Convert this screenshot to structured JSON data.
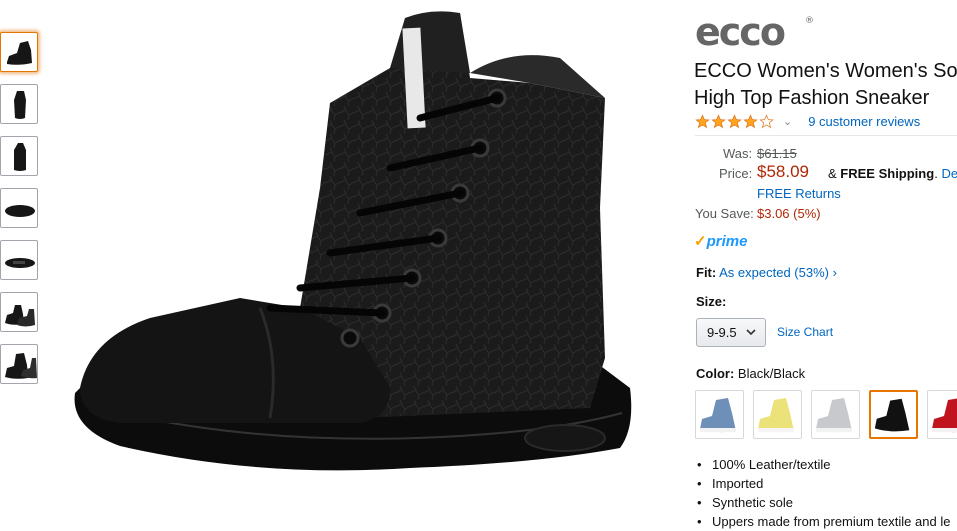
{
  "brand": {
    "logo_text": "ecco",
    "registered_mark": "®"
  },
  "product": {
    "title_line1": "ECCO Women's Women's So",
    "title_line2": "High Top Fashion Sneaker",
    "rating": 4,
    "reviews_link": "9 customer reviews"
  },
  "thumbnails": [
    {
      "name": "side-view",
      "selected": true
    },
    {
      "name": "front-view",
      "selected": false
    },
    {
      "name": "back-view",
      "selected": false
    },
    {
      "name": "sole-view",
      "selected": false
    },
    {
      "name": "top-view",
      "selected": false
    },
    {
      "name": "pair-view",
      "selected": false
    },
    {
      "name": "angle-view",
      "selected": false
    }
  ],
  "price": {
    "was_label": "Was:",
    "was_value": "$61.15",
    "price_label": "Price:",
    "price_value": "$58.09",
    "shipping_amp": "&",
    "shipping_bold": "FREE Shipping",
    "shipping_dot": ".",
    "details_link": "Detail",
    "returns_link": "FREE Returns",
    "save_label": "You Save:",
    "save_value": "$3.06 (5%)"
  },
  "prime": {
    "check": "✓",
    "label": "prime"
  },
  "fit": {
    "label": "Fit:",
    "value": "As expected (53%)",
    "chevron": "›"
  },
  "size": {
    "label": "Size:",
    "selected": "9-9.5",
    "chart_link": "Size Chart"
  },
  "color": {
    "label": "Color:",
    "value": "Black/Black",
    "swatches": [
      {
        "name": "denim-blue",
        "hex": "#6d8fb8",
        "selected": false
      },
      {
        "name": "yellow",
        "hex": "#ece27a",
        "selected": false
      },
      {
        "name": "light-grey",
        "hex": "#c7c9cc",
        "selected": false
      },
      {
        "name": "black",
        "hex": "#111111",
        "selected": true
      },
      {
        "name": "red",
        "hex": "#c0141f",
        "selected": false
      }
    ]
  },
  "features": [
    "100% Leather/textile",
    "Imported",
    "Synthetic sole",
    "Uppers made from premium textile and le"
  ],
  "colors": {
    "link": "#0066c0",
    "price_red": "#b12704",
    "selection_orange": "#e77600",
    "star": "#ffa41c"
  }
}
